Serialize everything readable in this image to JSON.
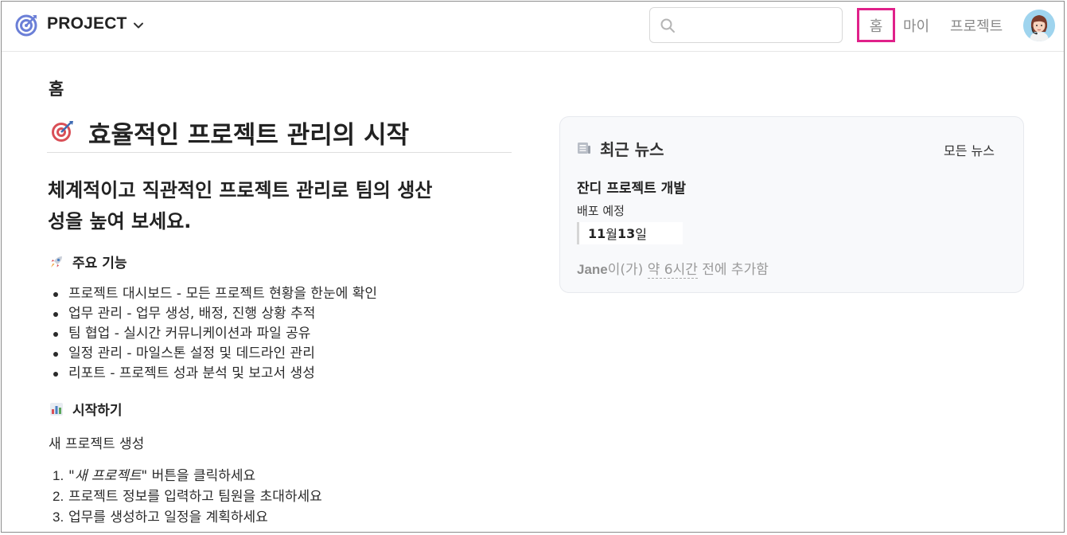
{
  "header": {
    "brand": "PROJECT",
    "search_placeholder": "",
    "nav": {
      "home": "홈",
      "my": "마이",
      "project": "프로젝트"
    }
  },
  "main": {
    "page_title": "홈",
    "hero": "효율적인 프로젝트 관리의 시작",
    "subtitle_line1": "체계적이고 직관적인 프로젝트 관리로 팀의 생산",
    "subtitle_line2": "성을 높여 보세요.",
    "features_heading": "주요 기능",
    "features": [
      "프로젝트 대시보드 - 모든 프로젝트 현황을 한눈에 확인",
      "업무 관리 - 업무 생성, 배정, 진행 상황 추적",
      "팀 협업 - 실시간 커뮤니케이션과 파일 공유",
      "일정 관리 - 마일스톤 설정 및 데드라인 관리",
      "리포트 - 프로젝트 성과 분석 및 보고서 생성"
    ],
    "start_heading": "시작하기",
    "start_para": "새 프로젝트 생성",
    "steps": [
      {
        "num": "1.",
        "em": "\"새 프로젝트\"",
        "rest": " 버튼을 클릭하세요"
      },
      {
        "num": "2.",
        "em": "",
        "rest": "프로젝트 정보를 입력하고 팀원을 초대하세요"
      },
      {
        "num": "3.",
        "em": "",
        "rest": "업무를 생성하고 일정을 계획하세요"
      }
    ]
  },
  "news": {
    "title": "최근 뉴스",
    "all_link": "모든 뉴스",
    "item_title": "잔디 프로젝트 개발",
    "item_sub": "배포 예정",
    "month_num": "11",
    "month_unit": "월 ",
    "day_num": "13",
    "day_unit": "일",
    "meta_author": "Jane",
    "meta_mid": "이(가) ",
    "meta_time": "약 6시간",
    "meta_end": " 전에 추가함"
  },
  "colors": {
    "highlight": "#e0218a",
    "muted": "#8a8a8a"
  },
  "icons": {
    "logo": "target-logo-icon",
    "search": "search-icon",
    "chevron": "chevron-down-icon",
    "rocket": "rocket-icon",
    "chart": "bar-chart-icon",
    "news": "newspaper-icon",
    "dart": "dart-target-icon"
  }
}
